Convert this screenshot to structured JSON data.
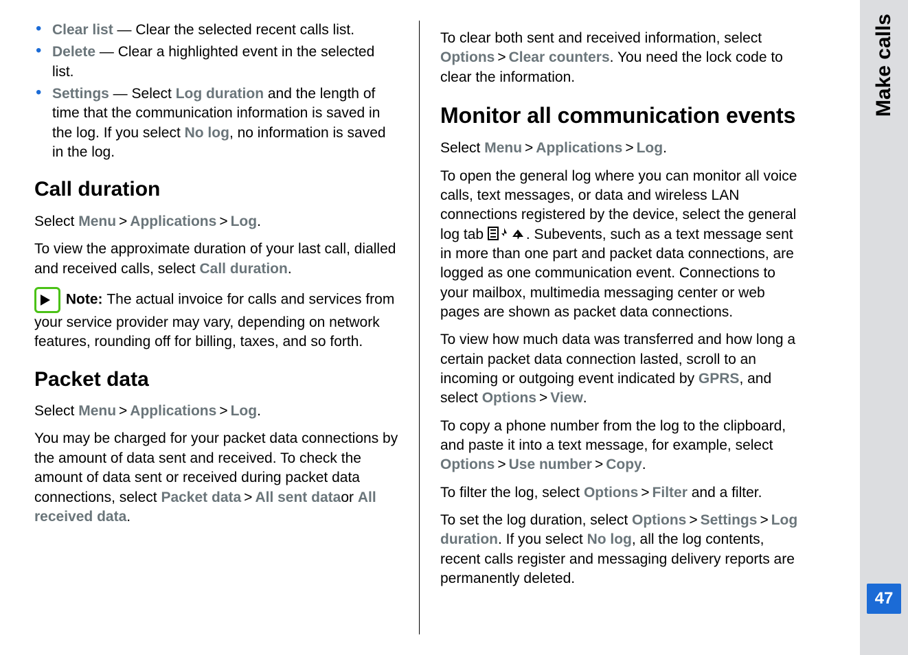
{
  "sidebar": {
    "label": "Make calls",
    "page": "47"
  },
  "left": {
    "bullets": [
      {
        "term": "Clear list",
        "desc": "  —  Clear the selected recent calls list."
      },
      {
        "term": "Delete",
        "desc": "  —  Clear a highlighted event in the selected list."
      },
      {
        "term": "Settings",
        "desc": "  —  Select ",
        "opt": "Log duration",
        "desc2": " and the length of time that the communication information is saved in the log. If you select ",
        "opt2": "No log",
        "desc3": ", no information is saved in the log."
      }
    ],
    "h_callduration": "Call duration",
    "path_prefix": "Select ",
    "menu": "Menu",
    "apps": "Applications",
    "log": "Log",
    "duration_p": "To view the approximate duration of your last call, dialled and received calls, select ",
    "duration_opt": "Call duration",
    "note_label": "Note:  ",
    "note_text": "The actual invoice for calls and services from your service provider may vary, depending on network features, rounding off for billing, taxes, and so forth.",
    "h_packet": "Packet data",
    "packet_p1": "You may be charged for your packet data connections by the amount of data sent and received. To check the amount of data sent or received during packet data connections, select ",
    "packet_opt1": "Packet data",
    "packet_opt2": "All sent data",
    "packet_or": "or ",
    "packet_opt3": "All received data"
  },
  "right": {
    "clear_p1": "To clear both sent and received information, select ",
    "clear_opt1": "Options",
    "clear_opt2": "Clear counters",
    "clear_p2": ". You need the lock code to clear the information.",
    "h_monitor": "Monitor all communication events",
    "open_p1": "To open the general log where you can monitor all voice calls, text messages, or data and wireless LAN connections registered by the device, select the general log tab ",
    "open_p2": ". Subevents, such as a text message sent in more than one part and packet data connections, are logged as one communication event. Connections to your mailbox, multimedia messaging center or web pages are shown as packet data connections.",
    "view_p1": "To view how much data was transferred and how long a certain packet data connection lasted, scroll to an incoming or outgoing event indicated by ",
    "gprs": "GPRS",
    "view_p2": ", and select ",
    "view_opt1": "Options",
    "view_opt2": "View",
    "copy_p1": "To copy a phone number from the log to the clipboard, and paste it into a text message, for example, select ",
    "copy_opt1": "Options",
    "copy_opt2": "Use number",
    "copy_opt3": "Copy",
    "filter_p1": "To filter the log, select ",
    "filter_opt1": "Options",
    "filter_opt2": "Filter",
    "filter_p2": " and a filter.",
    "dur_p1": "To set the log duration, select ",
    "dur_opt1": "Options",
    "dur_opt2": "Settings",
    "dur_opt3": "Log duration",
    "dur_p2": ". If you select ",
    "dur_opt4": "No log",
    "dur_p3": ", all the log contents, recent calls register and messaging delivery reports are permanently deleted."
  }
}
